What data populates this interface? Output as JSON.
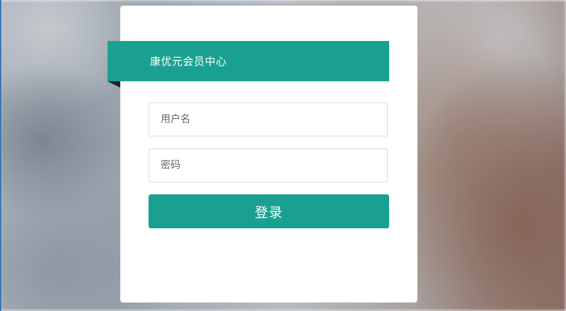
{
  "header": {
    "title": "康优元会员中心"
  },
  "form": {
    "username_placeholder": "用户名",
    "username_value": "",
    "password_placeholder": "密码",
    "password_value": "",
    "login_label": "登录"
  },
  "colors": {
    "accent": "#1aa091",
    "card_background": "#ffffff"
  }
}
